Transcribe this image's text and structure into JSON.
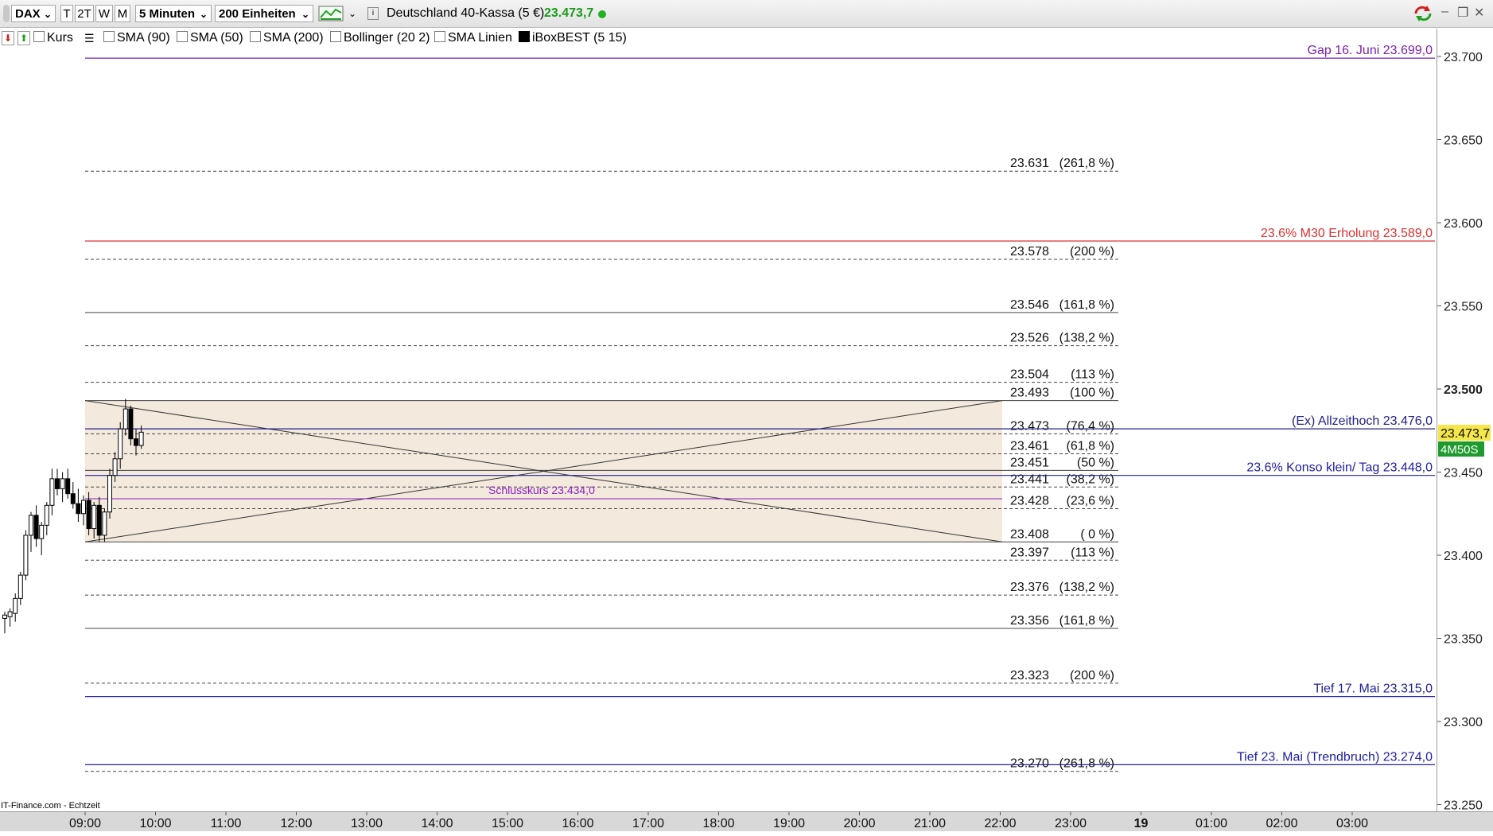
{
  "toolbar": {
    "symbol": "DAX",
    "buttons": [
      "T",
      "2T",
      "W",
      "M"
    ],
    "interval": "5 Minuten",
    "units": "200 Einheiten",
    "instrument": "Deutschland 40-Kassa (5 €)",
    "last_price": "23.473,7"
  },
  "legend": {
    "kurs": "Kurs",
    "items": [
      {
        "label": "SMA (90)",
        "checked": false
      },
      {
        "label": "SMA (50)",
        "checked": false
      },
      {
        "label": "SMA (200)",
        "checked": false
      },
      {
        "label": "Bollinger (20 2)",
        "checked": false
      },
      {
        "label": "SMA Linien",
        "checked": false
      },
      {
        "label": "iBoxBEST (5 15)",
        "checked": true
      }
    ]
  },
  "footer_source": "IT-Finance.com - Echtzeit",
  "chart_data": {
    "type": "candlestick",
    "ylim": [
      23250,
      23720
    ],
    "y_ticks": [
      "23.700",
      "23.650",
      "23.600",
      "23.550",
      "23.500",
      "23.450",
      "23.400",
      "23.350",
      "23.300",
      "23.250"
    ],
    "bold_tick": "23.500",
    "x_ticks": [
      "09:00",
      "10:00",
      "11:00",
      "12:00",
      "13:00",
      "14:00",
      "15:00",
      "16:00",
      "17:00",
      "18:00",
      "19:00",
      "20:00",
      "21:00",
      "22:00",
      "23:00",
      "19",
      "01:00",
      "02:00",
      "03:00"
    ],
    "bold_x_tick": "19",
    "price_marker": "23.473,7",
    "countdown": "4M50S",
    "candles": [
      {
        "o": 23362,
        "h": 23366,
        "l": 23353,
        "c": 23364
      },
      {
        "o": 23363,
        "h": 23368,
        "l": 23357,
        "c": 23366
      },
      {
        "o": 23365,
        "h": 23377,
        "l": 23360,
        "c": 23374
      },
      {
        "o": 23374,
        "h": 23390,
        "l": 23370,
        "c": 23388
      },
      {
        "o": 23388,
        "h": 23415,
        "l": 23385,
        "c": 23412
      },
      {
        "o": 23412,
        "h": 23426,
        "l": 23402,
        "c": 23424
      },
      {
        "o": 23424,
        "h": 23430,
        "l": 23405,
        "c": 23410
      },
      {
        "o": 23410,
        "h": 23420,
        "l": 23400,
        "c": 23418
      },
      {
        "o": 23418,
        "h": 23432,
        "l": 23412,
        "c": 23430
      },
      {
        "o": 23430,
        "h": 23452,
        "l": 23424,
        "c": 23446
      },
      {
        "o": 23446,
        "h": 23452,
        "l": 23436,
        "c": 23440
      },
      {
        "o": 23440,
        "h": 23450,
        "l": 23432,
        "c": 23446
      },
      {
        "o": 23446,
        "h": 23452,
        "l": 23434,
        "c": 23437
      },
      {
        "o": 23437,
        "h": 23444,
        "l": 23428,
        "c": 23431
      },
      {
        "o": 23431,
        "h": 23440,
        "l": 23420,
        "c": 23425
      },
      {
        "o": 23425,
        "h": 23436,
        "l": 23418,
        "c": 23433
      },
      {
        "o": 23433,
        "h": 23438,
        "l": 23412,
        "c": 23416
      },
      {
        "o": 23416,
        "h": 23432,
        "l": 23410,
        "c": 23430
      },
      {
        "o": 23430,
        "h": 23435,
        "l": 23408,
        "c": 23412
      },
      {
        "o": 23412,
        "h": 23428,
        "l": 23408,
        "c": 23426
      },
      {
        "o": 23426,
        "h": 23452,
        "l": 23422,
        "c": 23448
      },
      {
        "o": 23448,
        "h": 23462,
        "l": 23444,
        "c": 23458
      },
      {
        "o": 23458,
        "h": 23480,
        "l": 23452,
        "c": 23476
      },
      {
        "o": 23476,
        "h": 23494,
        "l": 23472,
        "c": 23488
      },
      {
        "o": 23488,
        "h": 23490,
        "l": 23466,
        "c": 23470
      },
      {
        "o": 23470,
        "h": 23476,
        "l": 23460,
        "c": 23466
      },
      {
        "o": 23466,
        "h": 23478,
        "l": 23464,
        "c": 23474
      }
    ],
    "fib_levels": [
      {
        "value": 23631,
        "label": "23.631",
        "pct": "(261,8 %)",
        "style": "dashed"
      },
      {
        "value": 23578,
        "label": "23.578",
        "pct": "(200 %)",
        "style": "dashed"
      },
      {
        "value": 23546,
        "label": "23.546",
        "pct": "(161,8 %)",
        "style": "solid"
      },
      {
        "value": 23526,
        "label": "23.526",
        "pct": "(138,2 %)",
        "style": "dashed"
      },
      {
        "value": 23504,
        "label": "23.504",
        "pct": "(113 %)",
        "style": "dashed"
      },
      {
        "value": 23493,
        "label": "23.493",
        "pct": "(100 %)",
        "style": "solid"
      },
      {
        "value": 23473,
        "label": "23.473",
        "pct": "(76,4 %)",
        "style": "dashed"
      },
      {
        "value": 23461,
        "label": "23.461",
        "pct": "(61,8 %)",
        "style": "dashed"
      },
      {
        "value": 23451,
        "label": "23.451",
        "pct": "(50 %)",
        "style": "solid"
      },
      {
        "value": 23441,
        "label": "23.441",
        "pct": "(38,2 %)",
        "style": "dashed"
      },
      {
        "value": 23428,
        "label": "23.428",
        "pct": "(23,6 %)",
        "style": "dashed"
      },
      {
        "value": 23408,
        "label": "23.408",
        "pct": "( 0 %)",
        "style": "solid"
      },
      {
        "value": 23397,
        "label": "23.397",
        "pct": "(113 %)",
        "style": "dashed"
      },
      {
        "value": 23376,
        "label": "23.376",
        "pct": "(138,2 %)",
        "style": "dashed"
      },
      {
        "value": 23356,
        "label": "23.356",
        "pct": "(161,8 %)",
        "style": "solid"
      },
      {
        "value": 23323,
        "label": "23.323",
        "pct": "(200 %)",
        "style": "dashed"
      },
      {
        "value": 23270,
        "label": "23.270",
        "pct": "(261,8 %)",
        "style": "dashed"
      }
    ],
    "horizontal_lines": [
      {
        "value": 23699,
        "label": "Gap 16. Juni 23.699,0",
        "color": "#7a20b0"
      },
      {
        "value": 23589,
        "label": "23.6% M30 Erholung 23.589,0",
        "color": "#e03030"
      },
      {
        "value": 23476,
        "label": "(Ex) Allzeithoch  23.476,0",
        "color": "#20208a"
      },
      {
        "value": 23448,
        "label": "23.6% Konso klein/ Tag 23.448,0",
        "color": "#2020a0"
      },
      {
        "value": 23315,
        "label": "Tief 17. Mai  23.315,0",
        "color": "#2020a0"
      },
      {
        "value": 23274,
        "label": "Tief 23. Mai (Trendbruch) 23.274,0",
        "color": "#2020a0"
      }
    ],
    "close_line": {
      "value": 23434,
      "label": "Schlusskurs 23.434,0",
      "color": "#8a20c0"
    },
    "range_box": {
      "high": 23493,
      "low": 23408
    }
  }
}
